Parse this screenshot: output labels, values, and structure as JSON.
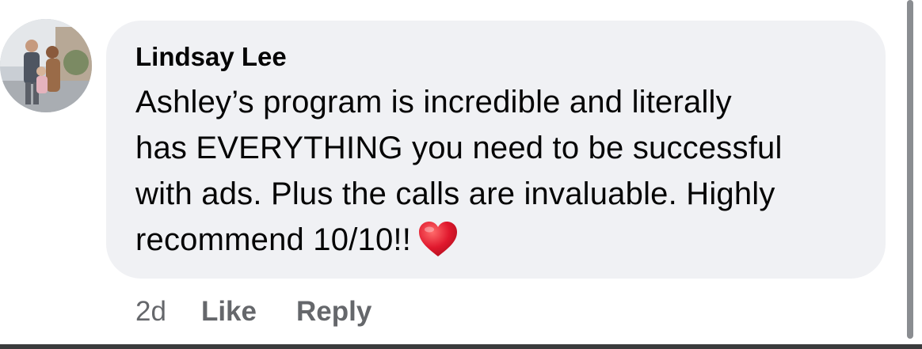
{
  "comment": {
    "author": "Lindsay Lee",
    "text_lines": [
      "Ashley’s program is incredible and literally",
      "has EVERYTHING you need to be successful",
      "with ads. Plus the calls are invaluable. Highly",
      "recommend 10/10!!"
    ],
    "emoji_icon": "red-heart-icon",
    "colors": {
      "bubble": "#f0f1f4",
      "text": "#050505",
      "meta": "#65676b",
      "heart": "#e0182d"
    }
  },
  "actions": {
    "timestamp": "2d",
    "like_label": "Like",
    "reply_label": "Reply"
  },
  "avatar": {
    "icon": "profile-photo-avatar"
  }
}
